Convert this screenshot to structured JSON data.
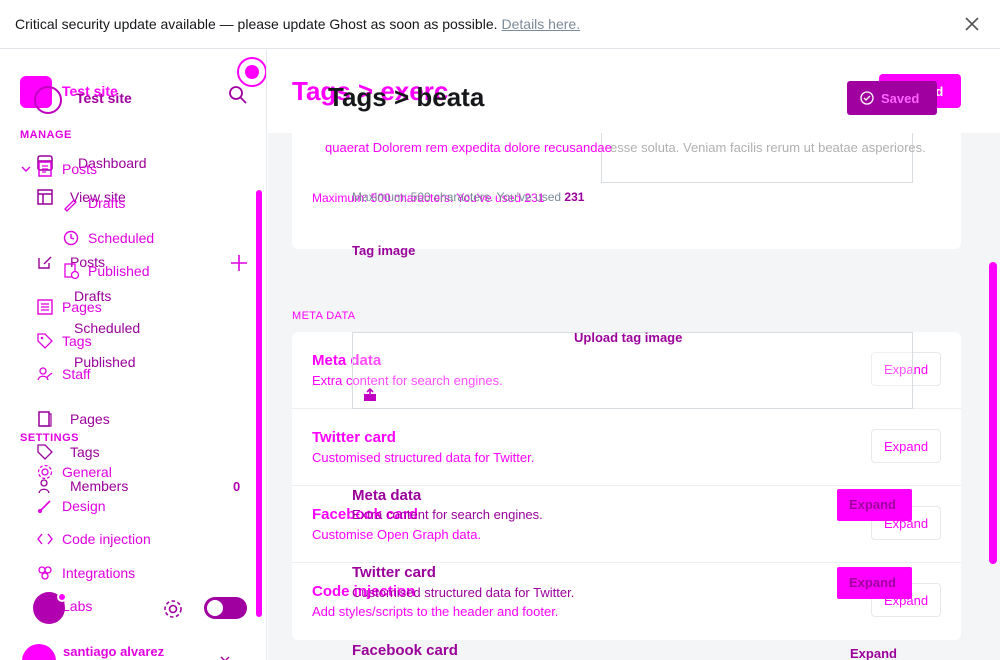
{
  "notice": {
    "text": "Critical security update available — please update Ghost as soon as possible.",
    "link": "Details here."
  },
  "sidebar": {
    "site_title": "Test site",
    "site_title_overlay": "Test site",
    "manage_heading": "MANAGE",
    "settings_heading": "SETTINGS",
    "items": {
      "dashboard": "Dashboard",
      "posts": "Posts",
      "view_site": "View site",
      "drafts": "Drafts",
      "scheduled": "Scheduled",
      "posts2": "Posts",
      "published": "Published",
      "drafts2": "Drafts",
      "pages": "Pages",
      "scheduled2": "Scheduled",
      "tags": "Tags",
      "published2": "Published",
      "staff": "Staff",
      "pages2": "Pages",
      "tags2": "Tags",
      "general": "General",
      "members": "Members",
      "members_count": "0",
      "design": "Design",
      "code_injection": "Code injection",
      "integrations": "Integrations",
      "labs": "Labs"
    },
    "user_name": "santiago alvarez"
  },
  "header": {
    "crumb_overlay": "Tags  >  exerc",
    "crumb": "Tags  >  beata",
    "saved_overlay": "Saved",
    "saved": "Saved"
  },
  "description": {
    "text": "quaerat Dolorem rem expedita dolore recusandae",
    "text_underlay": "esse soluta. Veniam facilis rerum ut beatae asperiores.",
    "max_overlay": "Maximum: 500 characters. You've used 231",
    "max_label": "Maximum: 500 characters. You've used",
    "max_count": "231"
  },
  "tag_image": {
    "label": "Tag image",
    "upload": "Upload tag image"
  },
  "meta": {
    "heading": "META DATA",
    "rows": [
      {
        "title": "Meta data",
        "subtitle": "Extra content for search engines.",
        "button": "Expand"
      },
      {
        "title": "Twitter card",
        "subtitle": "Customised structured data for Twitter.",
        "button": "Expand"
      },
      {
        "title": "Facebook card",
        "subtitle": "Customise Open Graph data.",
        "button": "Expand"
      },
      {
        "title": "Code injection",
        "subtitle": "Add styles/scripts to the header and footer.",
        "button": "Expand"
      }
    ],
    "overlay_rows": [
      {
        "title": "Meta data",
        "subtitle": "Extra content for search engines.",
        "button": "Expand"
      },
      {
        "title": "Twitter card",
        "subtitle": "Customised structured data for Twitter.",
        "button": "Expand"
      },
      {
        "title": "Facebook card",
        "button": "Expand"
      }
    ]
  },
  "colors": {
    "accent": "#ff00ff",
    "accent_dark": "#a000a0",
    "text": "#15171a",
    "muted": "#7c8b9a"
  }
}
